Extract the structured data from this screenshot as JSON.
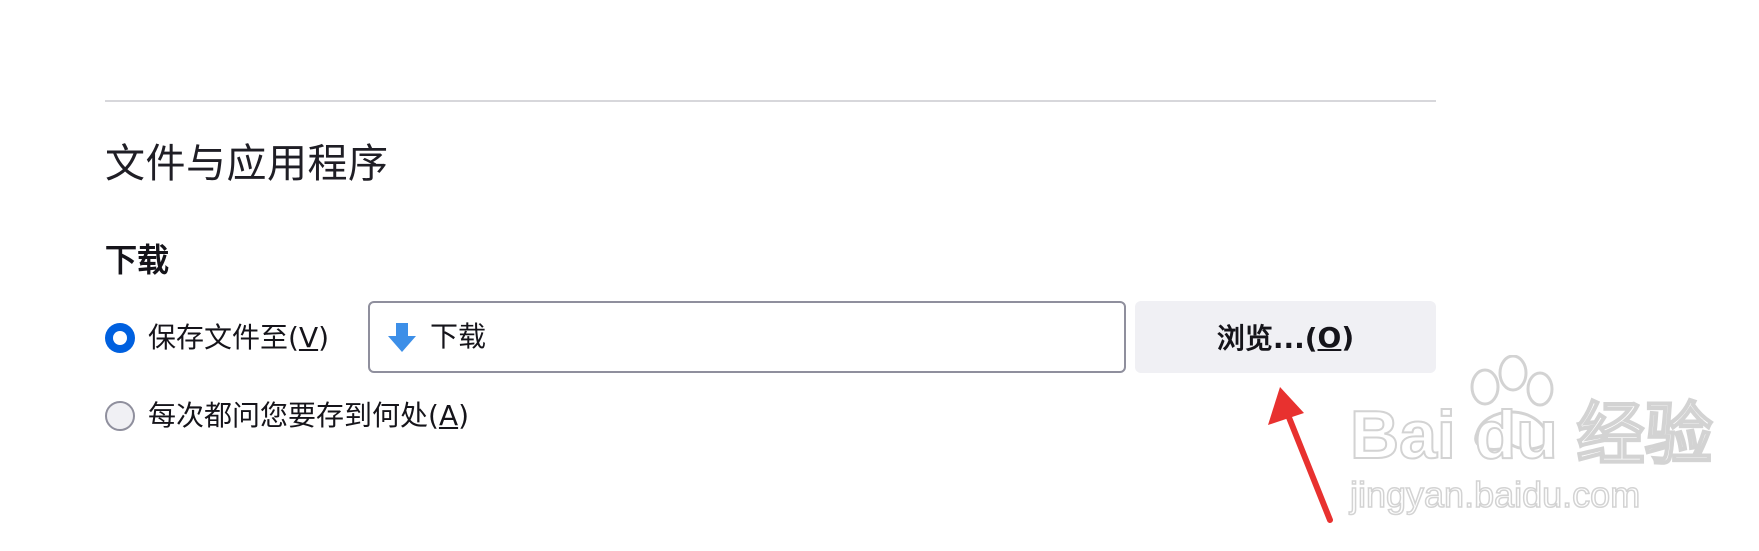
{
  "section": {
    "title": "文件与应用程序"
  },
  "downloads": {
    "heading": "下载",
    "save_to": {
      "label": "保存文件至(",
      "accesskey": "V",
      "label_end": ")",
      "checked": true
    },
    "path": {
      "value": "下载",
      "icon": "download-arrow-icon"
    },
    "browse_button": {
      "label": "浏览...(",
      "accesskey": "O",
      "label_end": ")"
    },
    "always_ask": {
      "label": "每次都问您要存到何处(",
      "accesskey": "A",
      "label_end": ")",
      "checked": false
    }
  },
  "watermark": {
    "brand": "Bai du 经验",
    "url": "jingyan.baidu.com"
  },
  "colors": {
    "accent": "#0060df",
    "annotation_arrow": "#e8312f",
    "button_bg": "#f0f0f4",
    "border": "#8f8f9d",
    "download_icon": "#3d8fe8"
  }
}
